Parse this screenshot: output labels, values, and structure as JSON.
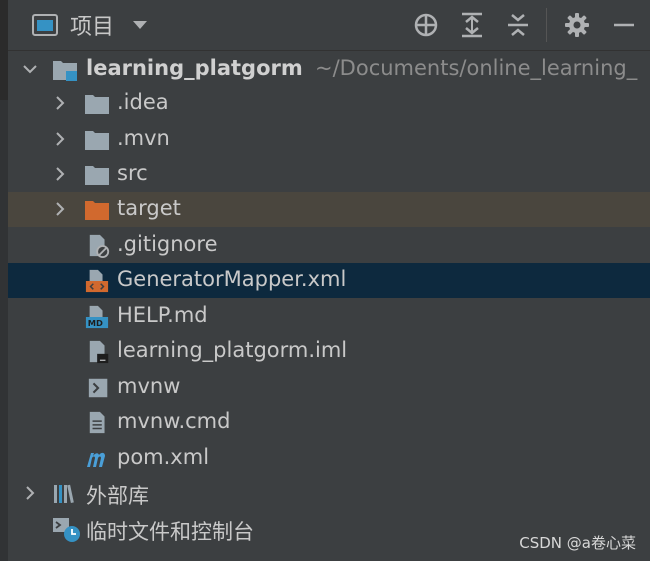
{
  "header": {
    "title": "项目",
    "tools": [
      "locate-icon",
      "expand-all-icon",
      "collapse-all-icon",
      "gear-icon",
      "minimize-icon"
    ]
  },
  "tree": {
    "root": {
      "name": "learning_platgorm",
      "path": "~/Documents/online_learning_"
    },
    "items": [
      {
        "label": ".idea",
        "icon": "folder-icon",
        "expandable": true
      },
      {
        "label": ".mvn",
        "icon": "folder-icon",
        "expandable": true
      },
      {
        "label": "src",
        "icon": "folder-icon",
        "expandable": true
      },
      {
        "label": "target",
        "icon": "excluded-folder-icon",
        "expandable": true,
        "highlight": "excluded"
      },
      {
        "label": ".gitignore",
        "icon": "ignored-file-icon",
        "expandable": false
      },
      {
        "label": "GeneratorMapper.xml",
        "icon": "xml-file-icon",
        "expandable": false,
        "selected": true
      },
      {
        "label": "HELP.md",
        "icon": "markdown-file-icon",
        "expandable": false
      },
      {
        "label": "learning_platgorm.iml",
        "icon": "iml-file-icon",
        "expandable": false
      },
      {
        "label": "mvnw",
        "icon": "shell-script-icon",
        "expandable": false
      },
      {
        "label": "mvnw.cmd",
        "icon": "text-file-icon",
        "expandable": false
      },
      {
        "label": "pom.xml",
        "icon": "maven-icon",
        "expandable": false
      }
    ],
    "external": {
      "label": "外部库"
    },
    "scratches": {
      "label": "临时文件和控制台"
    }
  },
  "watermark": "CSDN @a卷心菜",
  "colors": {
    "background": "#3c3f41",
    "selected_row": "#0d293e",
    "excluded_row": "#4a463e",
    "excluded_folder": "#d1692e",
    "maven": "#4a9fd8",
    "module_badge": "#3592c4"
  }
}
